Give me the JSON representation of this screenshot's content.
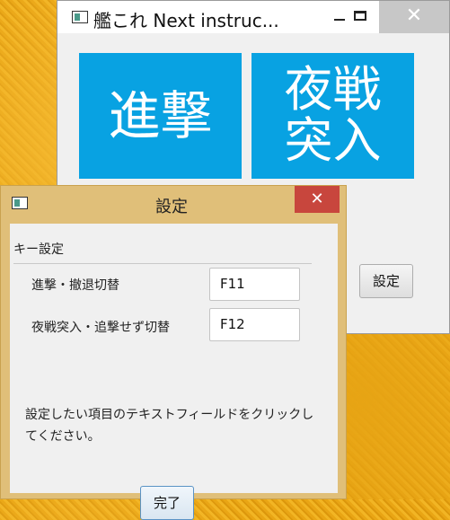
{
  "main_window": {
    "title": "艦これ Next instruc...",
    "close_symbol": "✕",
    "tile_advance": "進撃",
    "tile_night_line1": "夜戦",
    "tile_night_line2": "突入",
    "settings_button": "設定"
  },
  "dialog": {
    "title": "設定",
    "close_symbol": "✕",
    "group_label": "キー設定",
    "rows": [
      {
        "label": "進撃・撤退切替",
        "key": "F11"
      },
      {
        "label": "夜戦突入・追撃せず切替",
        "key": "F12"
      }
    ],
    "instruction": "設定したい項目のテキストフィールドをクリックしてください。",
    "done_button": "完了"
  }
}
